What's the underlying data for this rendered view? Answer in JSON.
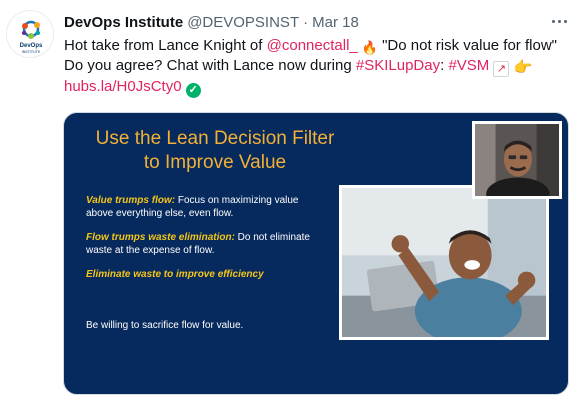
{
  "tweet": {
    "display_name": "DevOps Institute",
    "handle": "@DEVOPSINST",
    "separator": "·",
    "date": "Mar 18",
    "avatar_text": "DevOps INSTITUTE",
    "text": {
      "part1": "Hot take from Lance Knight of ",
      "mention": "@connectall_",
      "part2": " \"Do not risk value for flow\"",
      "part3": "Do you agree? Chat with Lance now during ",
      "hashtag1": "#SKILupDay",
      "colon": ": ",
      "hashtag2": "#VSM",
      "link": "hubs.la/H0JsCty0"
    },
    "emojis": {
      "fire": "fire-emoji",
      "chart": "chart-increasing-emoji",
      "point": "backhand-index-pointing-right-emoji",
      "check": "white-check-mark-emoji"
    }
  },
  "card": {
    "title": "Use the Lean Decision Filter to Improve Value",
    "bullets": [
      {
        "highlight": "Value trumps flow:",
        "text": " Focus on maximizing value above everything else, even flow."
      },
      {
        "highlight": "Flow trumps waste elimination:",
        "text": " Do not eliminate waste at the expense of flow."
      },
      {
        "highlight": "Eliminate waste to improve efficiency",
        "text": ""
      }
    ],
    "footer": "Be willing to sacrifice flow for value."
  },
  "colors": {
    "card_background": "#072a5e",
    "title_orange": "#f2b035",
    "highlight_yellow": "#f5c518",
    "link_pink": "#e0245e",
    "secondary_text": "#536471"
  }
}
